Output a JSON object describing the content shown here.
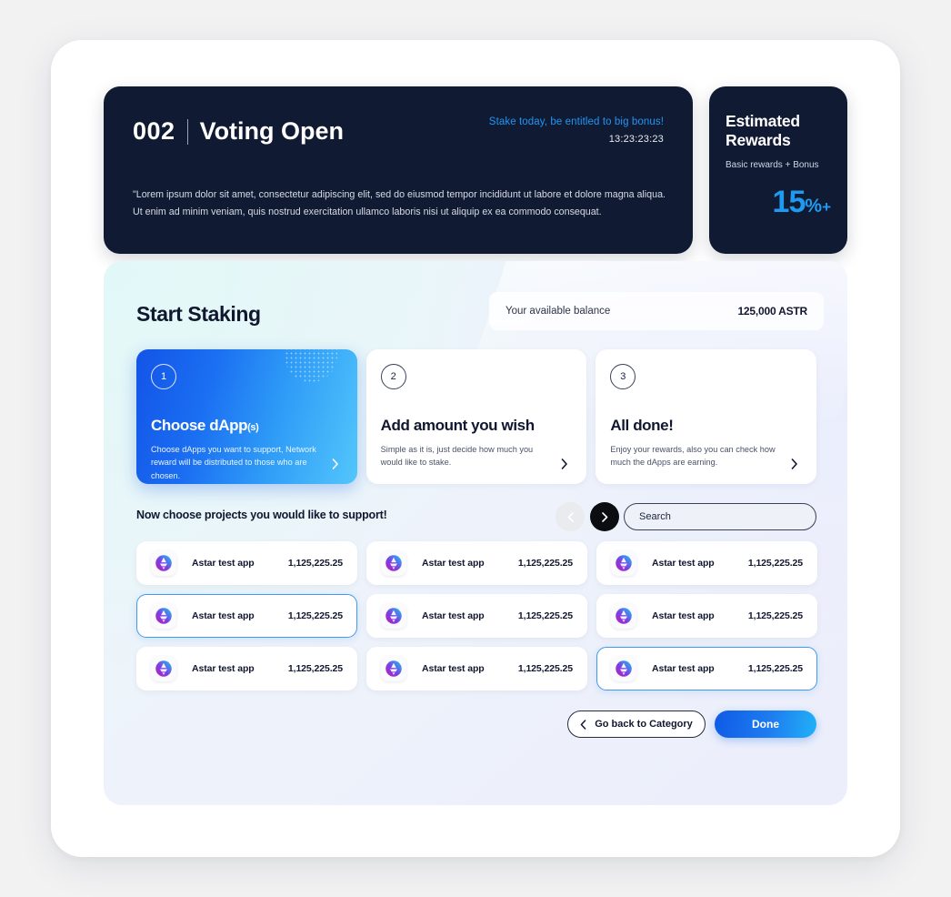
{
  "banner": {
    "number": "002",
    "status": "Voting Open",
    "promo": "Stake today, be entitled to big bonus!",
    "timer": "13:23:23:23",
    "description": "\"Lorem ipsum dolor sit amet, consectetur adipiscing elit, sed do eiusmod tempor incididunt ut labore et dolore magna aliqua. Ut enim ad minim veniam, quis nostrud exercitation ullamco laboris nisi ut aliquip ex ea commodo consequat."
  },
  "rewards": {
    "title": "Estimated Rewards",
    "subtitle": "Basic rewards + Bonus",
    "value": "15",
    "percent": "%",
    "plus": "+",
    "accent_color": "#1e9bf0"
  },
  "staking": {
    "title": "Start Staking",
    "balance_label": "Your available balance",
    "balance_value": "125,000 ASTR"
  },
  "steps": [
    {
      "badge": "1",
      "title": "Choose dApp",
      "title_sub": "(s)",
      "description": "Choose dApps you want to support, Network reward will be distributed to those who are chosen.",
      "arrow": "chevron-right-icon",
      "active": true
    },
    {
      "badge": "2",
      "title": "Add amount you wish",
      "title_sub": "",
      "description": "Simple as it is, just decide how much you would like to stake.",
      "arrow": "chevron-right-icon",
      "active": false
    },
    {
      "badge": "3",
      "title": "All done!",
      "title_sub": "",
      "description": "Enjoy your rewards, also you can check how much the dApps are earning.",
      "arrow": "chevron-right-icon",
      "active": false
    }
  ],
  "choose": {
    "label": "Now choose projects you would like to support!",
    "prev_icon": "chevron-left-icon",
    "next_icon": "chevron-right-icon",
    "search_placeholder": "Search",
    "search_value": ""
  },
  "dapps": [
    {
      "name": "Astar test app",
      "amount": "1,125,225.25",
      "selected": false
    },
    {
      "name": "Astar test app",
      "amount": "1,125,225.25",
      "selected": false
    },
    {
      "name": "Astar test app",
      "amount": "1,125,225.25",
      "selected": false
    },
    {
      "name": "Astar test app",
      "amount": "1,125,225.25",
      "selected": true
    },
    {
      "name": "Astar test app",
      "amount": "1,125,225.25",
      "selected": false
    },
    {
      "name": "Astar test app",
      "amount": "1,125,225.25",
      "selected": false
    },
    {
      "name": "Astar test app",
      "amount": "1,125,225.25",
      "selected": false
    },
    {
      "name": "Astar test app",
      "amount": "1,125,225.25",
      "selected": false
    },
    {
      "name": "Astar test app",
      "amount": "1,125,225.25",
      "selected": true
    }
  ],
  "footer": {
    "back_label": "Go back to Category",
    "back_icon": "chevron-left-icon",
    "done_label": "Done"
  }
}
